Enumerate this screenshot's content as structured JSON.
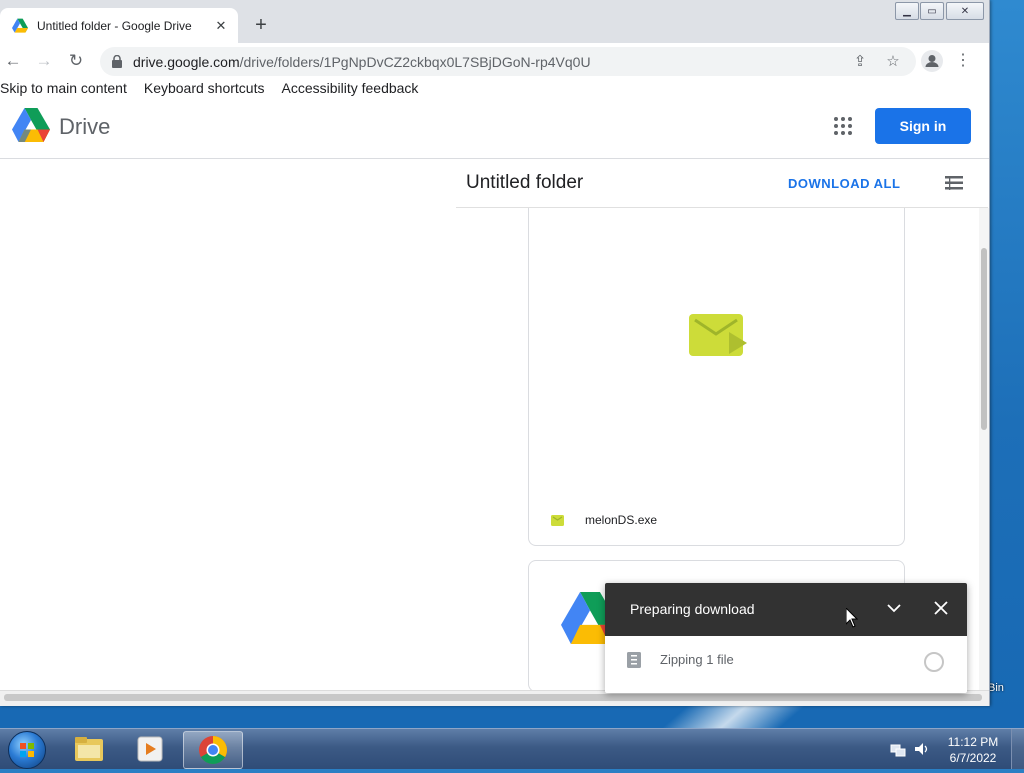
{
  "browser": {
    "tab_title": "Untitled folder - Google Drive",
    "new_tab_label": "+",
    "url_host": "drive.google.com",
    "url_path": "/drive/folders/1PgNpDvCZ2ckbqx0L7SBjDGoN-rp4Vq0U"
  },
  "page": {
    "skip_links": [
      "Skip to main content",
      "Keyboard shortcuts",
      "Accessibility feedback"
    ],
    "brand": "Drive",
    "sign_in_label": "Sign in",
    "folder_title": "Untitled folder",
    "download_all_label": "DOWNLOAD ALL",
    "files": [
      {
        "name": "melonDS.exe",
        "icon": "executable-file-icon",
        "color": "#cddc39"
      }
    ]
  },
  "download_toast": {
    "title": "Preparing download",
    "status": "Zipping 1 file"
  },
  "desktop": {
    "recycle_bin_fragment": "Bin"
  },
  "taskbar": {
    "clock_time": "11:12 PM",
    "clock_date": "6/7/2022",
    "apps": [
      "windows-explorer-icon",
      "media-player-icon",
      "chrome-icon"
    ]
  },
  "colors": {
    "accent_blue": "#1a73e8",
    "toast_header": "#323232",
    "file_green": "#cddc39"
  }
}
